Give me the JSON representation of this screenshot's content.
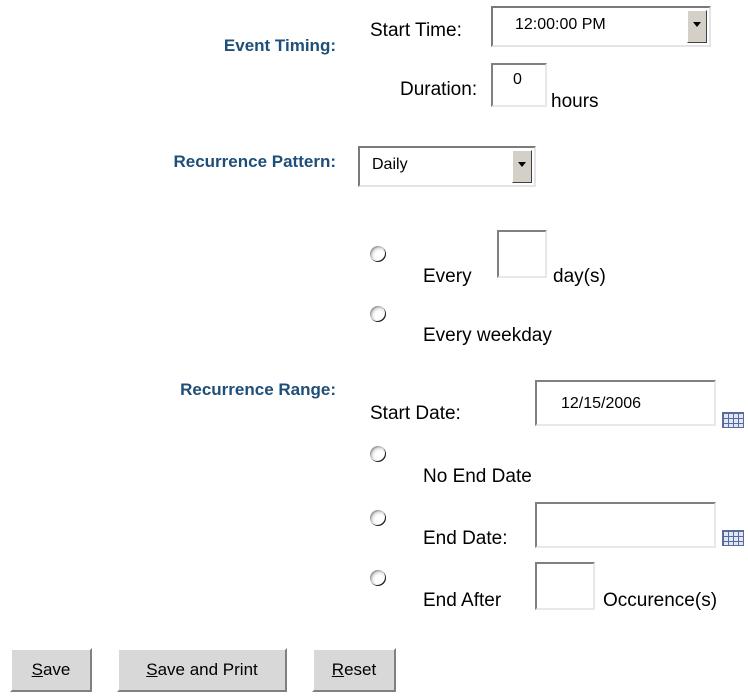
{
  "event_timing": {
    "section_label": "Event Timing:",
    "start_time_label": "Start Time:",
    "start_time_value": "12:00:00 PM",
    "duration_label": "Duration:",
    "duration_value": "0",
    "duration_unit": "hours"
  },
  "recurrence_pattern": {
    "section_label": "Recurrence Pattern:",
    "frequency_value": "Daily",
    "options": {
      "every_label": "Every",
      "every_days_value": "",
      "days_unit": "day(s)",
      "every_weekday_label": "Every weekday"
    }
  },
  "recurrence_range": {
    "section_label": "Recurrence Range:",
    "start_date_label": "Start Date:",
    "start_date_value": "12/15/2006",
    "no_end_date_label": "No End Date",
    "end_date_label": "End Date:",
    "end_date_value": "",
    "end_after_label": "End After",
    "occurrences_value": "",
    "occurrences_unit": "Occurence(s)"
  },
  "buttons": {
    "save": {
      "first": "S",
      "rest": "ave"
    },
    "save_and_print": {
      "first": "S",
      "rest": "ave and Print"
    },
    "reset": {
      "first": "R",
      "rest": "eset"
    }
  }
}
